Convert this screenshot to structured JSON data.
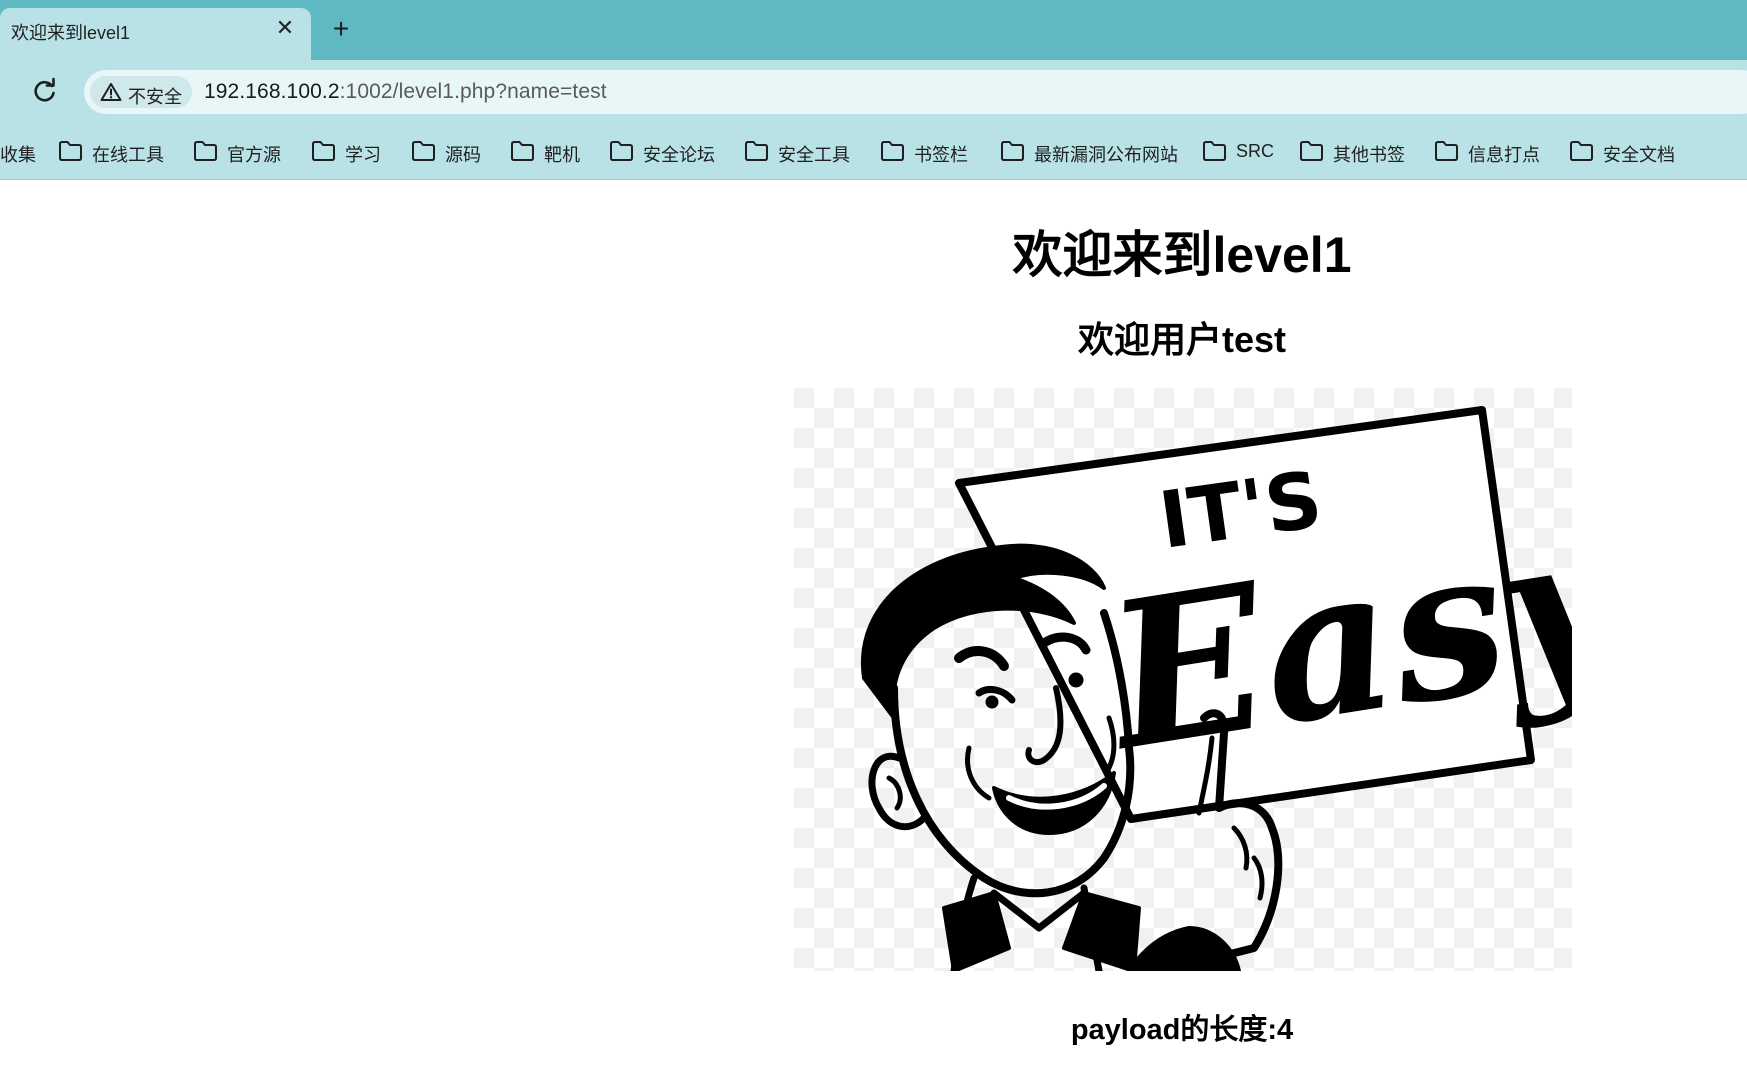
{
  "browser": {
    "tab": {
      "title": "欢迎来到level1",
      "close_glyph": "✕"
    },
    "new_tab_glyph": "+",
    "address": {
      "security_label": "不安全",
      "url_host": "192.168.100.2",
      "url_rest": ":1002/level1.php?name=test"
    },
    "bookmarks": [
      {
        "label": "收集",
        "icon": "folder-icon"
      },
      {
        "label": "在线工具",
        "icon": "folder-icon"
      },
      {
        "label": "官方源",
        "icon": "folder-icon"
      },
      {
        "label": "学习",
        "icon": "folder-icon"
      },
      {
        "label": "源码",
        "icon": "folder-icon"
      },
      {
        "label": "靶机",
        "icon": "folder-icon"
      },
      {
        "label": "安全论坛",
        "icon": "folder-icon"
      },
      {
        "label": "安全工具",
        "icon": "folder-icon"
      },
      {
        "label": "书签栏",
        "icon": "folder-icon"
      },
      {
        "label": "最新漏洞公布网站",
        "icon": "folder-icon"
      },
      {
        "label": "SRC",
        "icon": "folder-icon"
      },
      {
        "label": "其他书签",
        "icon": "folder-icon"
      },
      {
        "label": "信息打点",
        "icon": "folder-icon"
      },
      {
        "label": "安全文档",
        "icon": "folder-icon"
      }
    ]
  },
  "page": {
    "heading": "欢迎来到level1",
    "welcome": "欢迎用户test",
    "image": {
      "sign_line1": "IT'S",
      "sign_line2": "Easy"
    },
    "payload_length": "payload的长度:4"
  },
  "colors": {
    "tabstrip": "#5fb8c2",
    "toolbar": "#b9e2e6",
    "omnibox": "#e9f6f7"
  }
}
